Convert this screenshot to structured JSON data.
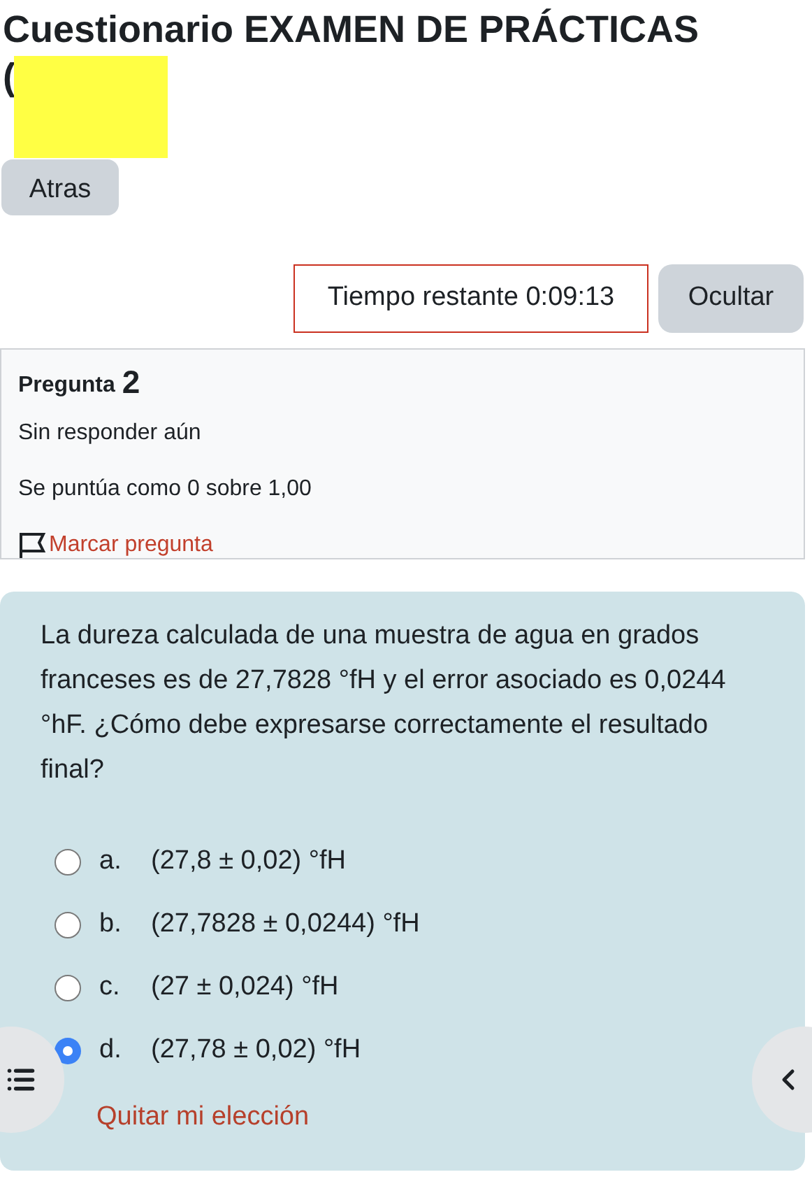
{
  "title": "Cuestionario EXAMEN DE PRÁCTICAS",
  "subtitle": "(",
  "back_button": "Atras",
  "timer": {
    "label": "Tiempo restante",
    "value": "0:09:13"
  },
  "hide_button": "Ocultar",
  "question_info": {
    "label": "Pregunta",
    "number": "2",
    "status": "Sin responder aún",
    "grade": "Se puntúa como 0 sobre 1,00",
    "flag": "Marcar pregunta"
  },
  "question": {
    "text": "La dureza calculada de una muestra de agua en grados franceses es de 27,7828 °fH y el error asociado es 0,0244 °hF. ¿Cómo debe expresarse correctamente el resultado final?",
    "options": [
      {
        "letter": "a.",
        "text": "(27,8 ± 0,02) °fH",
        "selected": false
      },
      {
        "letter": "b.",
        "text": "(27,7828 ± 0,0244) °fH",
        "selected": false
      },
      {
        "letter": "c.",
        "text": "(27 ± 0,024) °fH",
        "selected": false
      },
      {
        "letter": "d.",
        "text": "(27,78 ± 0,02) °fH",
        "selected": true
      }
    ],
    "clear_link": "Quitar mi elección"
  }
}
